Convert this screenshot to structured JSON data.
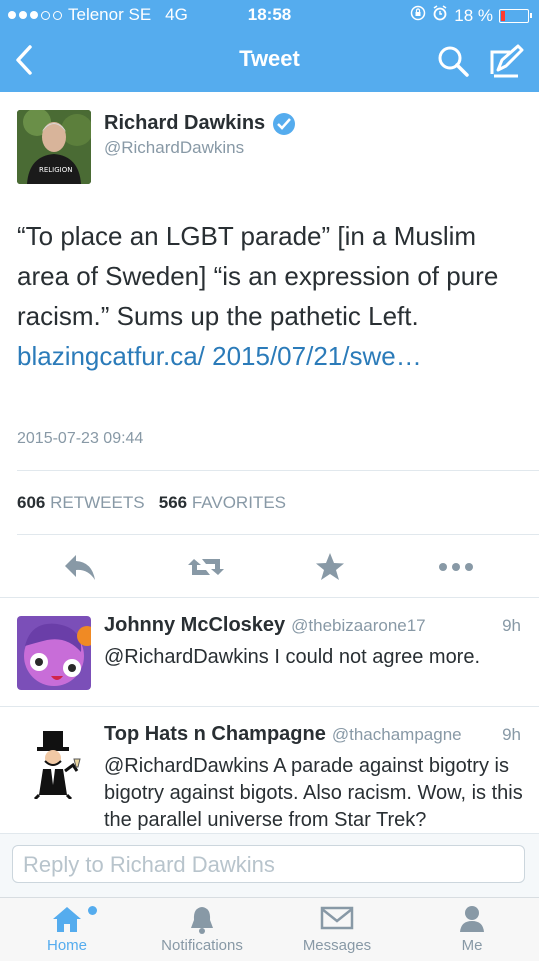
{
  "status_bar": {
    "carrier": "Telenor SE",
    "network": "4G",
    "time": "18:58",
    "battery": "18 %"
  },
  "nav": {
    "title": "Tweet",
    "back_icon": "chevron-left-icon",
    "search_icon": "search-icon",
    "compose_icon": "compose-icon"
  },
  "tweet": {
    "author_name": "Richard Dawkins",
    "author_handle": "@RichardDawkins",
    "avatar_shirt_text": "RELIGION",
    "text_main": "“To place an LGBT parade” [in a Muslim area of Sweden] “is an expression of pure racism.” Sums up the pathetic Left. ",
    "link": "blazingcatfur.ca/ 2015/07/21/swe…",
    "timestamp": "2015-07-23 09:44",
    "retweets_count": "606",
    "retweets_label": "RETWEETS",
    "favorites_count": "566",
    "favorites_label": "FAVORITES"
  },
  "actions": [
    "reply-icon",
    "retweet-icon",
    "star-icon",
    "more-icon"
  ],
  "replies": [
    {
      "name": "Johnny McCloskey",
      "handle": "@thebizaarone17",
      "time": "9h",
      "text": "@RichardDawkins I could not agree more."
    },
    {
      "name": "Top Hats n Champagne",
      "handle": "@thachampagne",
      "time": "9h",
      "text": "@RichardDawkins A parade against bigotry is bigotry against bigots. Also racism. Wow, is this the parallel universe from Star Trek?"
    }
  ],
  "reply_box": {
    "placeholder": "Reply to Richard Dawkins"
  },
  "tabs": [
    {
      "label": "Home",
      "icon": "home-icon",
      "active": true
    },
    {
      "label": "Notifications",
      "icon": "bell-icon"
    },
    {
      "label": "Messages",
      "icon": "envelope-icon"
    },
    {
      "label": "Me",
      "icon": "person-icon"
    }
  ],
  "colors": {
    "brand": "#55acee",
    "link": "#2b7bb9",
    "muted": "#8899a6",
    "text": "#292f33"
  }
}
